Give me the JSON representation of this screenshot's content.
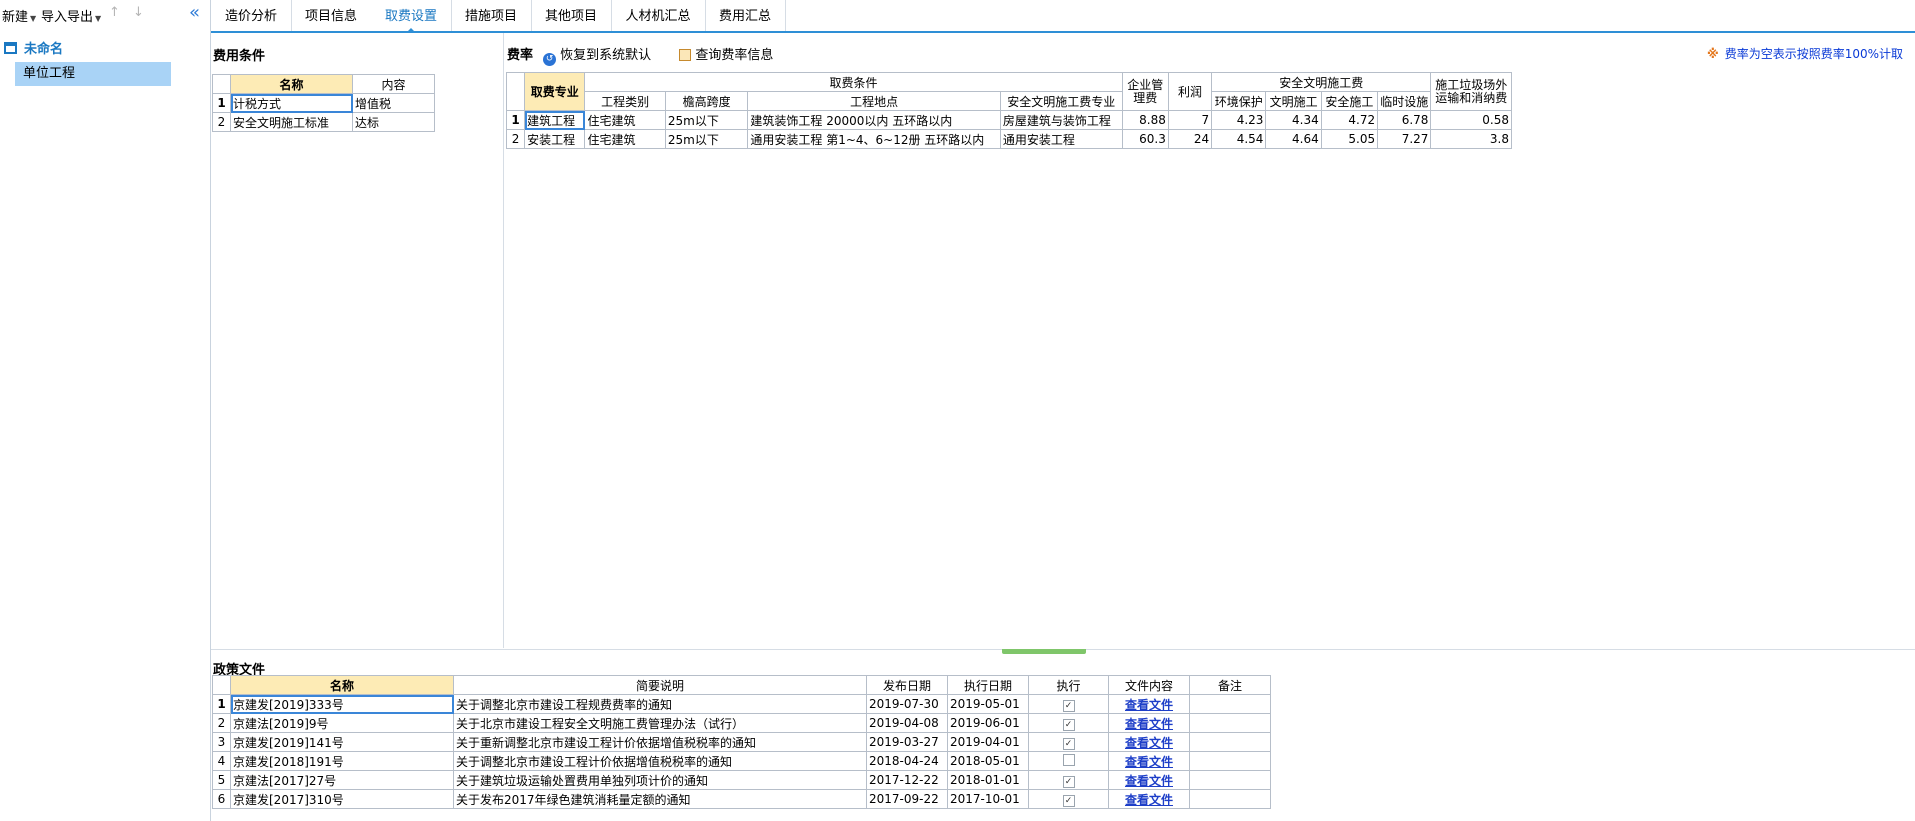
{
  "sidebar": {
    "new_label": "新建",
    "io_label": "导入导出",
    "up_icon": "↑",
    "down_icon": "↓",
    "collapse_icon": "«",
    "tree_root": "未命名",
    "tree_child": "单位工程"
  },
  "tabs": [
    "造价分析",
    "项目信息",
    "取费设置",
    "措施项目",
    "其他项目",
    "人材机汇总",
    "费用汇总"
  ],
  "active_tab": 2,
  "conditions": {
    "title": "费用条件",
    "headers": [
      "名称",
      "内容"
    ],
    "rows": [
      {
        "no": "1",
        "name": "计税方式",
        "value": "增值税"
      },
      {
        "no": "2",
        "name": "安全文明施工标准",
        "value": "达标"
      }
    ]
  },
  "rates": {
    "label": "费率",
    "restore_label": "恢复到系统默认",
    "query_label": "查询费率信息",
    "note": "费率为空表示按照费率100%计取",
    "header": {
      "specialty": "取费专业",
      "conditions": "取费条件",
      "mgmt": "企业管理费",
      "profit": "利润",
      "safety_group": "安全文明施工费",
      "waste": "施工垃圾场外运输和消纳费",
      "proj_type": "工程类别",
      "eaves": "檐高跨度",
      "location": "工程地点",
      "safety_spec": "安全文明施工费专业",
      "env": "环境保护",
      "civil": "文明施工",
      "safe": "安全施工",
      "temp": "临时设施"
    },
    "rows": [
      {
        "no": "1",
        "specialty": "建筑工程",
        "proj_type": "住宅建筑",
        "eaves": "25m以下",
        "location": "建筑装饰工程 20000以内 五环路以内",
        "safety_spec": "房屋建筑与装饰工程",
        "mgmt": "8.88",
        "profit": "7",
        "env": "4.23",
        "civil": "4.34",
        "safe": "4.72",
        "temp": "6.78",
        "waste": "0.58"
      },
      {
        "no": "2",
        "specialty": "安装工程",
        "proj_type": "住宅建筑",
        "eaves": "25m以下",
        "location": "通用安装工程 第1~4、6~12册 五环路以内",
        "safety_spec": "通用安装工程",
        "mgmt": "60.3",
        "profit": "24",
        "env": "4.54",
        "civil": "4.64",
        "safe": "5.05",
        "temp": "7.27",
        "waste": "3.8"
      }
    ]
  },
  "policy": {
    "title": "政策文件",
    "headers": [
      "名称",
      "简要说明",
      "发布日期",
      "执行日期",
      "执行",
      "文件内容",
      "备注"
    ],
    "view_label": "查看文件",
    "rows": [
      {
        "no": "1",
        "name": "京建发[2019]333号",
        "desc": "关于调整北京市建设工程规费费率的通知",
        "pub": "2019-07-30",
        "exec": "2019-05-01",
        "checked": "✓",
        "note": ""
      },
      {
        "no": "2",
        "name": "京建法[2019]9号",
        "desc": "关于北京市建设工程安全文明施工费管理办法（试行）",
        "pub": "2019-04-08",
        "exec": "2019-06-01",
        "checked": "✓",
        "note": ""
      },
      {
        "no": "3",
        "name": "京建发[2019]141号",
        "desc": "关于重新调整北京市建设工程计价依据增值税税率的通知",
        "pub": "2019-03-27",
        "exec": "2019-04-01",
        "checked": "✓",
        "note": ""
      },
      {
        "no": "4",
        "name": "京建发[2018]191号",
        "desc": "关于调整北京市建设工程计价依据增值税税率的通知",
        "pub": "2018-04-24",
        "exec": "2018-05-01",
        "checked": "",
        "note": ""
      },
      {
        "no": "5",
        "name": "京建法[2017]27号",
        "desc": "关于建筑垃圾运输处置费用单独列项计价的通知",
        "pub": "2017-12-22",
        "exec": "2018-01-01",
        "checked": "✓",
        "note": ""
      },
      {
        "no": "6",
        "name": "京建发[2017]310号",
        "desc": "关于发布2017年绿色建筑消耗量定额的通知",
        "pub": "2017-09-22",
        "exec": "2017-10-01",
        "checked": "✓",
        "note": ""
      }
    ]
  }
}
